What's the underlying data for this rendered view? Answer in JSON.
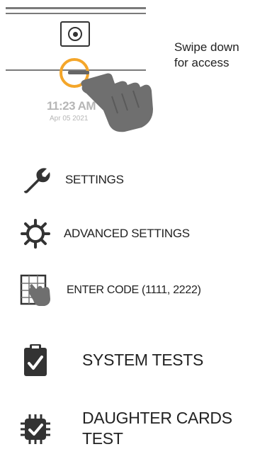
{
  "lock_screen": {
    "time": "11:23 AM",
    "date": "Apr 05 2021",
    "hint_line1": "Swipe down",
    "hint_line2": "for access"
  },
  "menu": {
    "settings": "SETTINGS",
    "advanced_settings": "ADVANCED SETTINGS",
    "enter_code": "ENTER CODE (1111, 2222)",
    "system_tests": "SYSTEM TESTS",
    "daughter_cards_line1": "DAUGHTER CARDS",
    "daughter_cards_line2": "TEST"
  },
  "colors": {
    "accent_orange": "#f4a62a",
    "icon_dark": "#333333",
    "hand_gray": "#6f6f6f"
  },
  "icons": {
    "settings": "wrench-icon",
    "advanced_settings": "gear-icon",
    "enter_code": "keypad-touch-icon",
    "system_tests": "clipboard-check-icon",
    "daughter_cards_test": "chip-check-icon"
  }
}
